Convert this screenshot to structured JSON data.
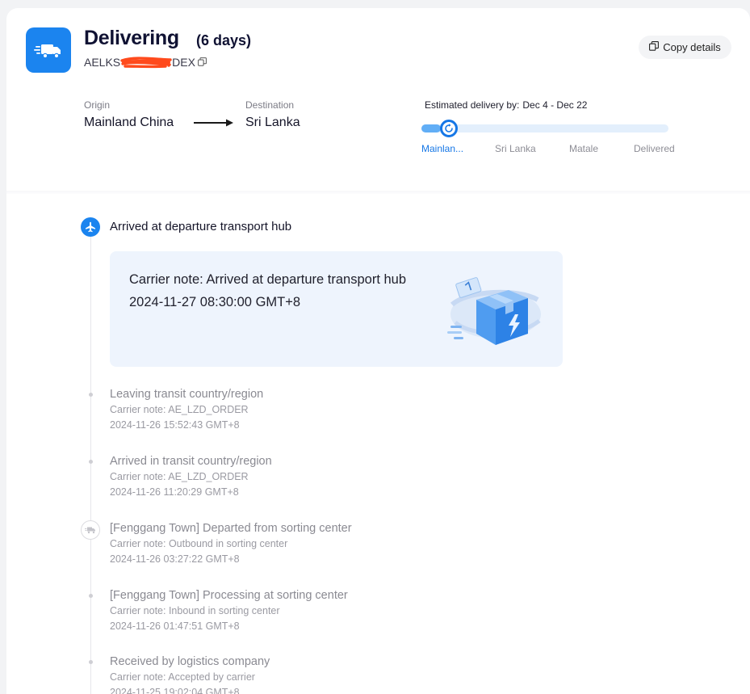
{
  "header": {
    "status": "Delivering",
    "days": "(6 days)",
    "tracking_prefix": "AELKS",
    "tracking_suffix": "DEX",
    "copy_details_label": "Copy details"
  },
  "route": {
    "origin_label": "Origin",
    "origin_value": "Mainland China",
    "destination_label": "Destination",
    "destination_value": "Sri Lanka"
  },
  "eta": {
    "label": "Estimated delivery by:",
    "value": "Dec 4 - Dec 22",
    "progress_percent": 8,
    "stages": [
      "Mainlan...",
      "Sri Lanka",
      "Matale",
      "Delivered"
    ],
    "active_stage": 0
  },
  "timeline": {
    "latest": {
      "title": "Arrived at departure transport hub",
      "note": "Carrier note: Arrived at departure transport hub",
      "date": "2024-11-27 08:30:00 GMT+8"
    },
    "events": [
      {
        "title": "Leaving transit country/region",
        "note": "Carrier note: AE_LZD_ORDER",
        "date": "2024-11-26 15:52:43 GMT+8"
      },
      {
        "title": "Arrived in transit country/region",
        "note": "Carrier note: AE_LZD_ORDER",
        "date": "2024-11-26 11:20:29 GMT+8"
      },
      {
        "title": "[Fenggang Town] Departed from sorting center",
        "note": "Carrier note: Outbound in sorting center",
        "date": "2024-11-26 03:27:22 GMT+8"
      },
      {
        "title": "[Fenggang Town] Processing at sorting center",
        "note": "Carrier note: Inbound in sorting center",
        "date": "2024-11-26 01:47:51 GMT+8"
      },
      {
        "title": "Received by logistics company",
        "note": "Carrier note: Accepted by carrier",
        "date": "2024-11-25 19:02:04 GMT+8"
      }
    ]
  },
  "colors": {
    "accent": "#1b84ef",
    "redaction": "#ff4a1c"
  }
}
